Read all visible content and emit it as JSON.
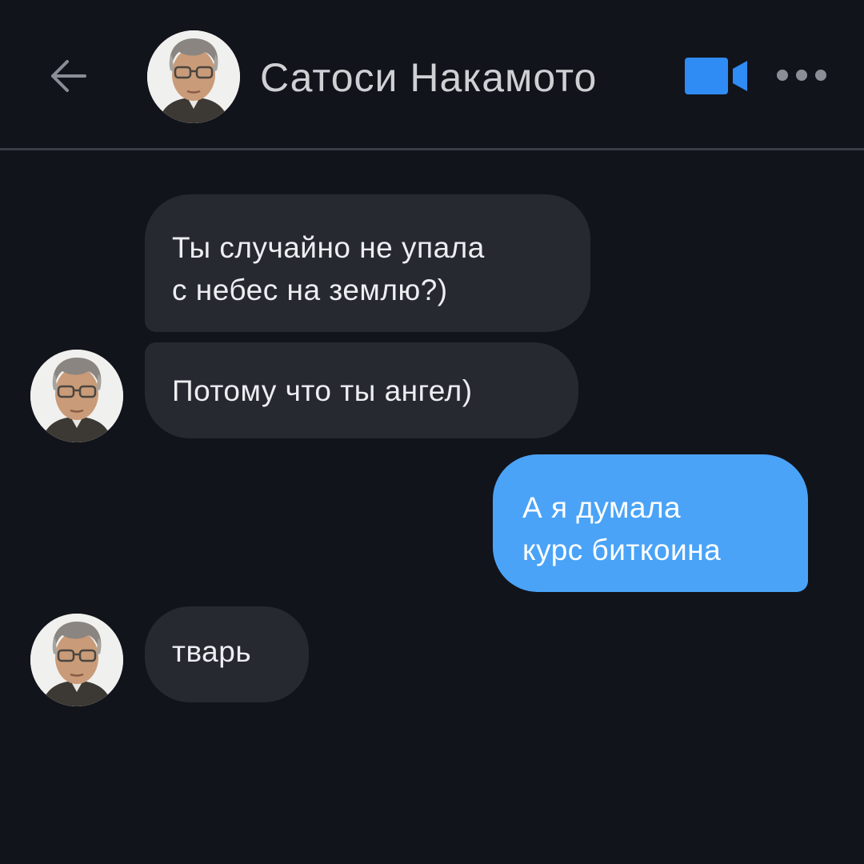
{
  "colors": {
    "background": "#12141b",
    "incoming_bubble": "#272931",
    "outgoing_bubble": "#4aa3f7",
    "accent": "#2f8cf5"
  },
  "header": {
    "back_icon": "arrow-left-icon",
    "contact_name": "Сатоси Накамото",
    "video_icon": "video-camera-icon",
    "more_icon": "more-dots-icon"
  },
  "messages": [
    {
      "direction": "incoming",
      "text": "Ты случайно не упала\nс небес на землю?)"
    },
    {
      "direction": "incoming",
      "text": "Потому что ты ангел)"
    },
    {
      "direction": "outgoing",
      "text": "А я думала\nкурс биткоина"
    },
    {
      "direction": "incoming",
      "text": "тварь"
    }
  ]
}
